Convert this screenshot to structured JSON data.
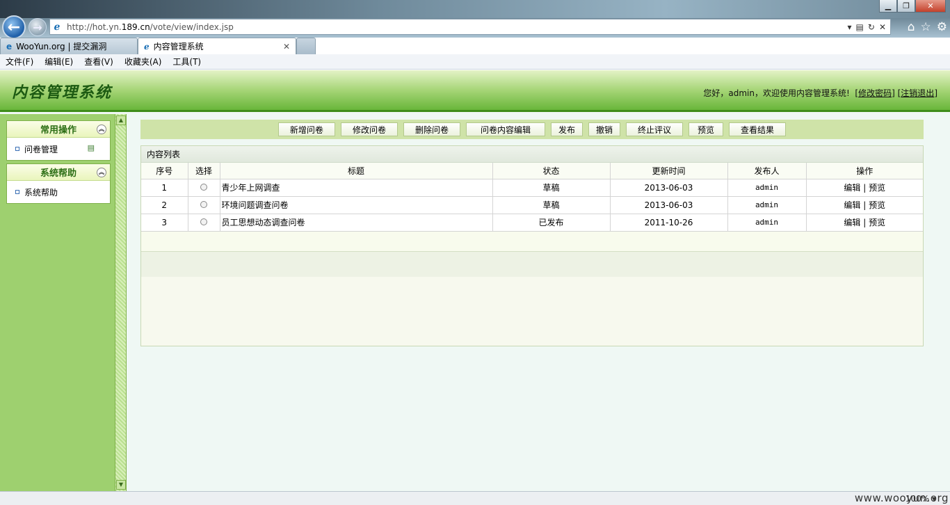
{
  "browser": {
    "url_prefix": "http://hot.yn.",
    "url_domain": "189.cn",
    "url_path": "/vote/view/index.jsp",
    "tabs": [
      {
        "label": "WooYun.org | 提交漏洞"
      },
      {
        "label": "内容管理系统"
      }
    ],
    "menu": [
      "文件(F)",
      "编辑(E)",
      "查看(V)",
      "收藏夹(A)",
      "工具(T)"
    ],
    "zoom": "100%",
    "watermark": "www.wooyun.org"
  },
  "header": {
    "system_title": "内容管理系统",
    "welcome_text": "您好，admin，欢迎使用内容管理系统!",
    "change_password": "修改密码",
    "logout": "注销退出"
  },
  "sidebar": {
    "panels": [
      {
        "title": "常用操作",
        "items": [
          {
            "label": "问卷管理"
          }
        ]
      },
      {
        "title": "系统帮助",
        "items": [
          {
            "label": "系统帮助"
          }
        ]
      }
    ]
  },
  "toolbar": {
    "buttons": [
      "新增问卷",
      "修改问卷",
      "删除问卷",
      "问卷内容编辑",
      "发布",
      "撤销",
      "终止评议",
      "预览",
      "查看结果"
    ]
  },
  "list": {
    "title": "内容列表",
    "columns": [
      "序号",
      "选择",
      "标题",
      "状态",
      "更新时间",
      "发布人",
      "操作"
    ],
    "rows": [
      {
        "no": "1",
        "title": "青少年上网调查",
        "status": "草稿",
        "updated": "2013-06-03",
        "publisher": "admin",
        "edit": "编辑",
        "sep": "|",
        "preview": "预览"
      },
      {
        "no": "2",
        "title": "环境问题调查问卷",
        "status": "草稿",
        "updated": "2013-06-03",
        "publisher": "admin",
        "edit": "编辑",
        "sep": "|",
        "preview": "预览"
      },
      {
        "no": "3",
        "title": "员工思想动态调查问卷",
        "status": "已发布",
        "updated": "2011-10-26",
        "publisher": "admin",
        "edit": "编辑",
        "sep": "|",
        "preview": "预览"
      }
    ]
  }
}
